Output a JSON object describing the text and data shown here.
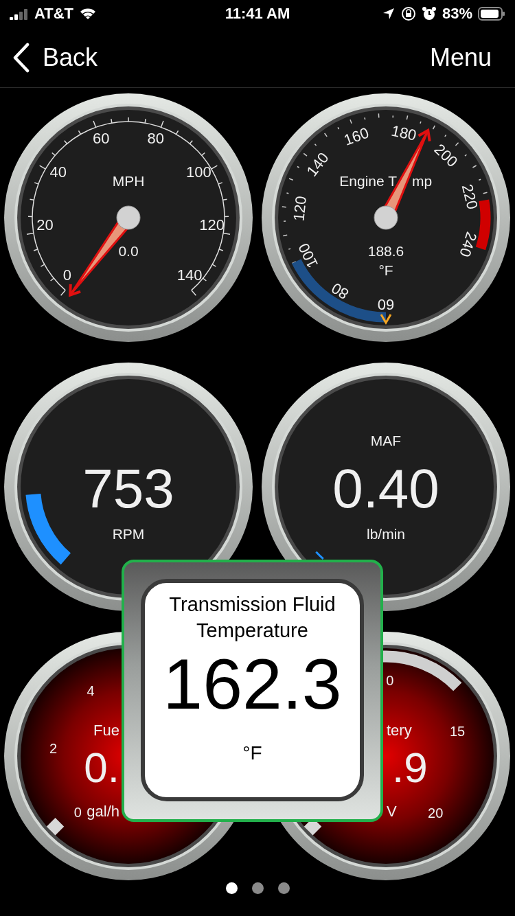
{
  "status_bar": {
    "carrier": "AT&T",
    "time": "11:41 AM",
    "battery": "83%"
  },
  "nav": {
    "back": "Back",
    "menu": "Menu"
  },
  "gauges": [
    {
      "kind": "speed",
      "title": "MPH",
      "value": "0.0",
      "ticks": [
        "0",
        "20",
        "40",
        "60",
        "80",
        "100",
        "120",
        "140"
      ]
    },
    {
      "kind": "temp",
      "title": "Engine T",
      "title_2": "mp",
      "value": "188.6",
      "unit": "°F",
      "ticks": [
        "60",
        "80",
        "100",
        "120",
        "140",
        "160",
        "180",
        "200",
        "220",
        "240"
      ]
    },
    {
      "kind": "digital",
      "value": "753",
      "unit": "RPM",
      "level": 0.16
    },
    {
      "kind": "digital",
      "title": "MAF",
      "value": "0.40",
      "unit": "lb/min"
    },
    {
      "kind": "fuel",
      "title": "Fue",
      "value": "0.",
      "unit": "gal/h",
      "ticks": [
        "0",
        "2",
        "4"
      ],
      "band": false
    },
    {
      "kind": "voltage",
      "title": "tery",
      "value": ".9",
      "unit": "V",
      "ticks": [
        "0",
        "15",
        "20"
      ],
      "band": true
    }
  ],
  "popup": {
    "title": "Transmission Fluid Temperature",
    "value": "162.3",
    "unit": "°F"
  },
  "pages": [
    {
      "selected": true
    },
    {
      "selected": false
    },
    {
      "selected": false
    }
  ]
}
